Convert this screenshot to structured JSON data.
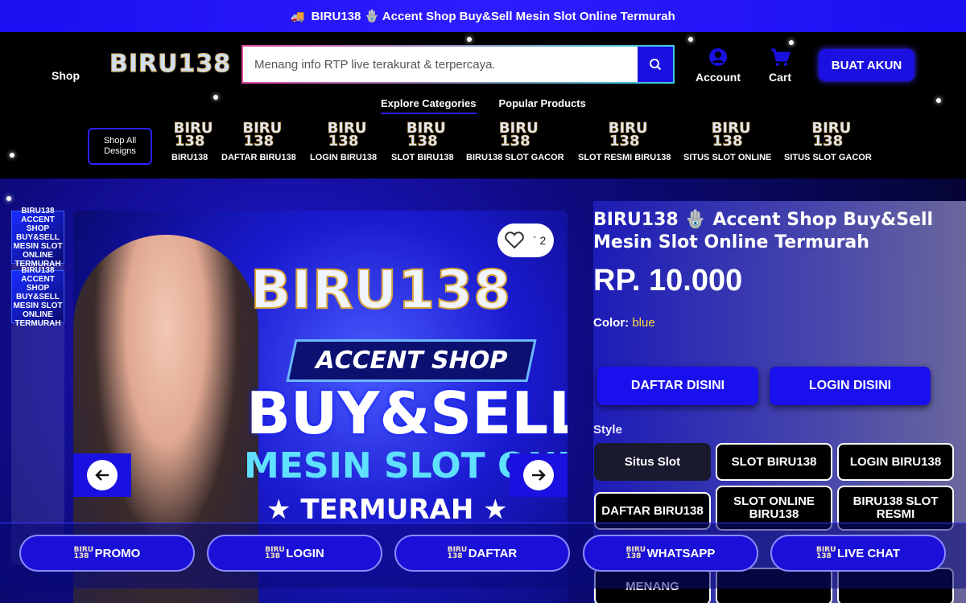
{
  "announcement": {
    "icon": "truck-icon",
    "text": "BIRU138 🪬 Accent Shop Buy&Sell Mesin Slot Online Termurah"
  },
  "header": {
    "shop_label": "Shop",
    "logo_text": "BIRU138",
    "search": {
      "value": "Menang info RTP live terakurat & terpercaya."
    },
    "account_label": "Account",
    "cart_label": "Cart",
    "cta_label": "BUAT AKUN",
    "tabs": [
      {
        "label": "Explore Categories"
      },
      {
        "label": "Popular Products"
      }
    ],
    "shop_all_label": "Shop All Designs",
    "category_logo": "BIRU 138",
    "categories": [
      {
        "label": "BIRU138"
      },
      {
        "label": "DAFTAR BIRU138"
      },
      {
        "label": "LOGIN BIRU138"
      },
      {
        "label": "SLOT BIRU138"
      },
      {
        "label": "BIRU138 SLOT GACOR"
      },
      {
        "label": "SLOT RESMI BIRU138"
      },
      {
        "label": "SITUS SLOT ONLINE"
      },
      {
        "label": "SITUS SLOT GACOR"
      }
    ]
  },
  "gallery": {
    "wishlist_count": "` 2",
    "hero": {
      "title": "BIRU138",
      "subtitle": "ACCENT SHOP",
      "line1": "BUY&SELL",
      "line2": "MESIN SLOT ONLINE",
      "line3": "★ TERMURAH ★"
    },
    "thumb_text": "BIRU138 ACCENT SHOP BUY&SELL MESIN SLOT ONLINE TERMURAH"
  },
  "product": {
    "title": "BIRU138 🪬 Accent Shop Buy&Sell Mesin Slot Online Termurah",
    "price": "RP. 10.000",
    "color_label": "Color:",
    "color_value": "blue",
    "daftar_label": "DAFTAR DISINI",
    "login_label": "LOGIN DISINI",
    "style_label": "Style",
    "styles": [
      {
        "label": "Situs Slot"
      },
      {
        "label": "SLOT BIRU138"
      },
      {
        "label": "LOGIN BIRU138"
      },
      {
        "label": "DAFTAR BIRU138"
      },
      {
        "label": "SLOT ONLINE BIRU138"
      },
      {
        "label": "BIRU138 SLOT RESMI"
      },
      {
        "label": "MENANG"
      }
    ]
  },
  "bottom_bar": [
    {
      "label": "PROMO"
    },
    {
      "label": "LOGIN"
    },
    {
      "label": "DAFTAR"
    },
    {
      "label": "WHATSAPP"
    },
    {
      "label": "LIVE CHAT"
    }
  ]
}
